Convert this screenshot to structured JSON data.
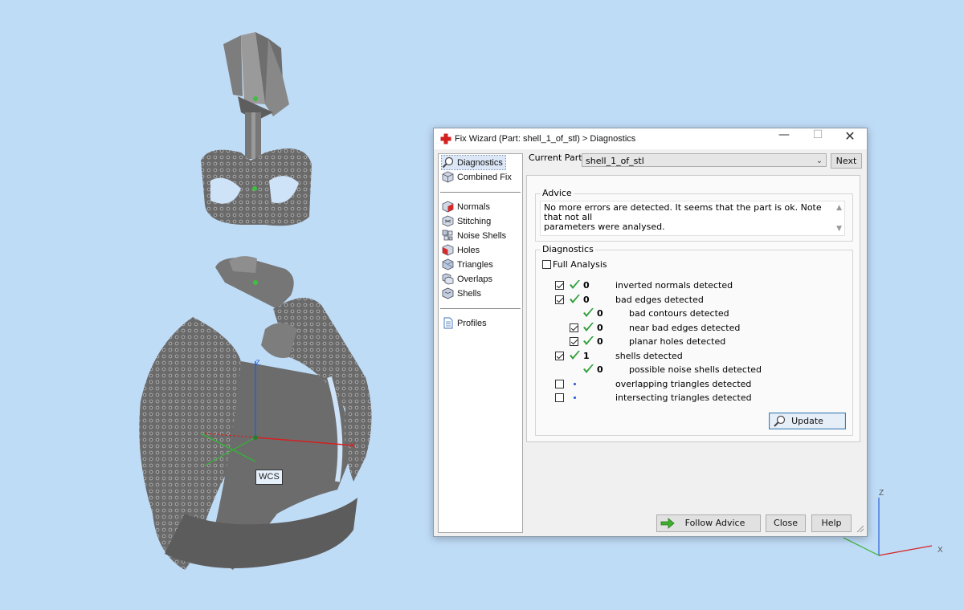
{
  "viewport": {
    "wcs_label": "WCS",
    "axis_labels": {
      "z": "Z",
      "x": "X"
    },
    "colors": {
      "background": "#bfdcf7",
      "part": "#6f6f6f",
      "axis_x": "#d62020",
      "axis_y": "#35b335",
      "axis_z": "#2a5fd6"
    }
  },
  "window": {
    "title": "Fix Wizard (Part: shell_1_of_stl) > Diagnostics",
    "icon": "red-cross-icon",
    "controls": {
      "minimize": "—",
      "maximize": "☐",
      "close": "✕"
    }
  },
  "nav": {
    "top_items": [
      {
        "label": "Diagnostics",
        "icon": "magnifier-icon",
        "selected": true
      },
      {
        "label": "Combined Fix",
        "icon": "cube-icon"
      }
    ],
    "tool_items": [
      {
        "label": "Normals",
        "icon": "normals-cube-icon"
      },
      {
        "label": "Stitching",
        "icon": "stitching-cube-icon"
      },
      {
        "label": "Noise Shells",
        "icon": "noise-shells-icon"
      },
      {
        "label": "Holes",
        "icon": "holes-cube-icon"
      },
      {
        "label": "Triangles",
        "icon": "triangles-cube-icon"
      },
      {
        "label": "Overlaps",
        "icon": "overlaps-icon"
      },
      {
        "label": "Shells",
        "icon": "shells-icon"
      }
    ],
    "bottom_items": [
      {
        "label": "Profiles",
        "icon": "document-icon"
      }
    ]
  },
  "current_part": {
    "label": "Current Part:",
    "value": "shell_1_of_stl",
    "next_label": "Next"
  },
  "advice": {
    "title": "Advice",
    "text_line1": "No more errors are detected. It seems that the part is ok. Note that not all",
    "text_line2": "parameters were analysed."
  },
  "diagnostics": {
    "title": "Diagnostics",
    "full_analysis": {
      "label": "Full Analysis",
      "checked": false
    },
    "rows": [
      {
        "checked": true,
        "status": "ok",
        "count": "0",
        "label": "inverted normals detected",
        "level": 0
      },
      {
        "checked": true,
        "status": "ok",
        "count": "0",
        "label": "bad edges detected",
        "level": 0
      },
      {
        "checked": null,
        "status": "ok",
        "count": "0",
        "label": "bad contours detected",
        "level": 1
      },
      {
        "checked": true,
        "status": "ok",
        "count": "0",
        "label": "near bad edges detected",
        "level": 1
      },
      {
        "checked": true,
        "status": "ok",
        "count": "0",
        "label": "planar holes detected",
        "level": 1
      },
      {
        "checked": true,
        "status": "ok",
        "count": "1",
        "label": "shells detected",
        "level": 0
      },
      {
        "checked": null,
        "status": "ok",
        "count": "0",
        "label": "possible noise shells detected",
        "level": 1
      },
      {
        "checked": false,
        "status": "pending",
        "count": "",
        "label": "overlapping triangles detected",
        "level": 0
      },
      {
        "checked": false,
        "status": "pending",
        "count": "",
        "label": "intersecting triangles detected",
        "level": 0
      }
    ],
    "update_label": "Update"
  },
  "footer": {
    "follow_advice": "Follow Advice",
    "close": "Close",
    "help": "Help"
  }
}
